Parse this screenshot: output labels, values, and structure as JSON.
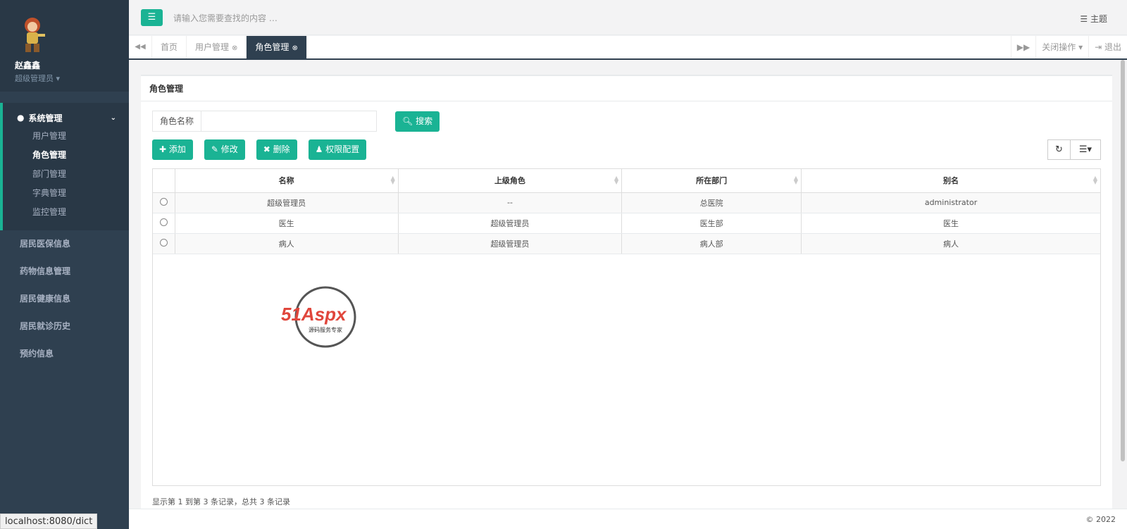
{
  "sidebar": {
    "user_name": "赵鑫鑫",
    "user_role": "超级管理员",
    "group_label": "系统管理",
    "sub_items": [
      "用户管理",
      "角色管理",
      "部门管理",
      "字典管理",
      "监控管理"
    ],
    "items": [
      "居民医保信息",
      "药物信息管理",
      "居民健康信息",
      "居民就诊历史",
      "预约信息"
    ]
  },
  "topbar": {
    "search_placeholder": "请输入您需要查找的内容 …",
    "theme_label": "主题"
  },
  "tabs": {
    "home": "首页",
    "user": "用户管理",
    "role": "角色管理",
    "close_ops": "关闭操作",
    "logout": "退出"
  },
  "panel": {
    "title": "角色管理",
    "search_label": "角色名称",
    "search_btn": "搜索",
    "add_btn": "添加",
    "edit_btn": "修改",
    "delete_btn": "删除",
    "perm_btn": "权限配置"
  },
  "table": {
    "headers": [
      "名称",
      "上级角色",
      "所在部门",
      "别名"
    ],
    "rows": [
      [
        "超级管理员",
        "--",
        "总医院",
        "administrator"
      ],
      [
        "医生",
        "超级管理员",
        "医生部",
        "医生"
      ],
      [
        "病人",
        "超级管理员",
        "病人部",
        "病人"
      ]
    ]
  },
  "pagination_info": "显示第 1 到第 3 条记录，总共 3 条记录",
  "watermark": {
    "brand": "51Aspx",
    "sub": "源码服务专家"
  },
  "footer": {
    "copyright": "© 2022"
  },
  "status_url": "localhost:8080/dict",
  "colors": {
    "accent": "#1ab394",
    "sidebar": "#2f4050"
  }
}
